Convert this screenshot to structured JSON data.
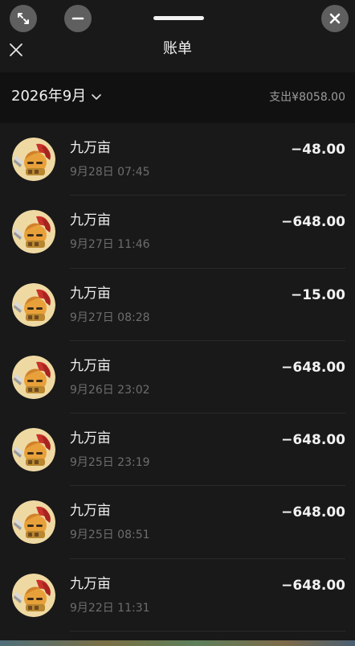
{
  "window": {
    "expand_icon": "expand-icon",
    "minimize_icon": "minus-icon",
    "close_icon": "close-icon"
  },
  "header": {
    "title": "账单",
    "close_icon": "close-icon"
  },
  "summary": {
    "month": "2026年9月",
    "chevron_icon": "chevron-down-icon",
    "expense": "支出¥8058.00"
  },
  "transactions": [
    {
      "merchant": "九万亩",
      "datetime": "9月28日 07:45",
      "amount": "−48.00"
    },
    {
      "merchant": "九万亩",
      "datetime": "9月27日 11:46",
      "amount": "−648.00"
    },
    {
      "merchant": "九万亩",
      "datetime": "9月27日 08:28",
      "amount": "−15.00"
    },
    {
      "merchant": "九万亩",
      "datetime": "9月26日 23:02",
      "amount": "−648.00"
    },
    {
      "merchant": "九万亩",
      "datetime": "9月25日 23:19",
      "amount": "−648.00"
    },
    {
      "merchant": "九万亩",
      "datetime": "9月25日 08:51",
      "amount": "−648.00"
    },
    {
      "merchant": "九万亩",
      "datetime": "9月22日 11:31",
      "amount": "−648.00"
    }
  ],
  "colors": {
    "background": "#191919",
    "summary_bar": "#111111",
    "primary_text": "#f2f2f2",
    "secondary_text": "#6d6d6d"
  }
}
